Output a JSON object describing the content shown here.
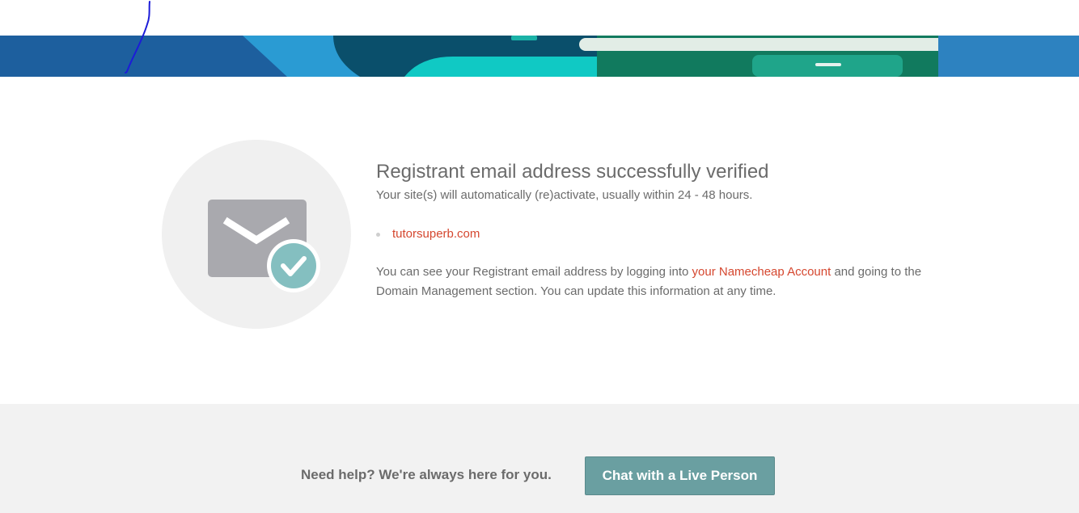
{
  "colors": {
    "accent_link": "#d5472f",
    "button_bg": "#6a9fa1",
    "text": "#6b6b6b",
    "footer_bg": "#f2f2f2",
    "check_badge": "#84bfc0"
  },
  "icons": {
    "illustration": "envelope-check-icon"
  },
  "message": {
    "title": "Registrant email address successfully verified",
    "subtitle": "Your site(s) will automatically (re)activate, usually within 24 - 48 hours.",
    "domains": [
      "tutorsuperb.com"
    ],
    "info_prefix": "You can see your Registrant email address by logging into ",
    "account_link": "your Namecheap Account",
    "info_suffix": " and going to the Domain Management section. You can update this information at any time."
  },
  "footer": {
    "help_text": "Need help? We're always here for you.",
    "chat_button": "Chat with a Live Person"
  }
}
